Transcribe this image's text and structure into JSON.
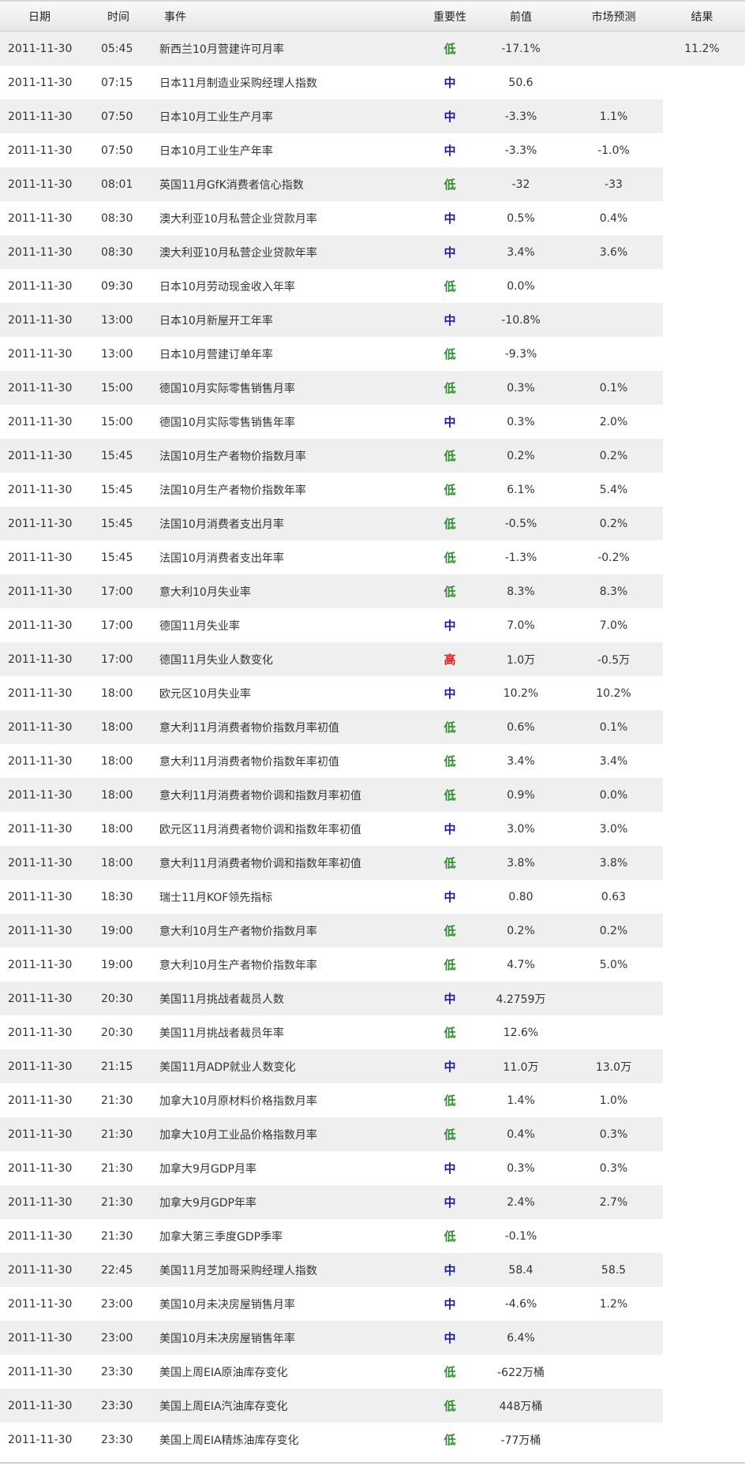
{
  "headers": {
    "date": "日期",
    "time": "时间",
    "event": "事件",
    "importance": "重要性",
    "previous": "前值",
    "forecast": "市场预测",
    "result": "结果"
  },
  "importance_colors": {
    "低": "#2e8b2e",
    "中": "#1a1aa8",
    "高": "#cc2222"
  },
  "rows": [
    {
      "date": "2011-11-30",
      "time": "05:45",
      "event": "新西兰10月营建许可月率",
      "importance": "低",
      "previous": "-17.1%",
      "forecast": "",
      "result": "11.2%"
    },
    {
      "date": "2011-11-30",
      "time": "07:15",
      "event": "日本11月制造业采购经理人指数",
      "importance": "中",
      "previous": "50.6",
      "forecast": "",
      "result": ""
    },
    {
      "date": "2011-11-30",
      "time": "07:50",
      "event": "日本10月工业生产月率",
      "importance": "中",
      "previous": "-3.3%",
      "forecast": "1.1%",
      "result": ""
    },
    {
      "date": "2011-11-30",
      "time": "07:50",
      "event": "日本10月工业生产年率",
      "importance": "中",
      "previous": "-3.3%",
      "forecast": "-1.0%",
      "result": ""
    },
    {
      "date": "2011-11-30",
      "time": "08:01",
      "event": "英国11月GfK消费者信心指数",
      "importance": "低",
      "previous": "-32",
      "forecast": "-33",
      "result": ""
    },
    {
      "date": "2011-11-30",
      "time": "08:30",
      "event": "澳大利亚10月私营企业贷款月率",
      "importance": "中",
      "previous": "0.5%",
      "forecast": "0.4%",
      "result": ""
    },
    {
      "date": "2011-11-30",
      "time": "08:30",
      "event": "澳大利亚10月私营企业贷款年率",
      "importance": "中",
      "previous": "3.4%",
      "forecast": "3.6%",
      "result": ""
    },
    {
      "date": "2011-11-30",
      "time": "09:30",
      "event": "日本10月劳动现金收入年率",
      "importance": "低",
      "previous": "0.0%",
      "forecast": "",
      "result": ""
    },
    {
      "date": "2011-11-30",
      "time": "13:00",
      "event": "日本10月新屋开工年率",
      "importance": "中",
      "previous": "-10.8%",
      "forecast": "",
      "result": ""
    },
    {
      "date": "2011-11-30",
      "time": "13:00",
      "event": "日本10月营建订单年率",
      "importance": "低",
      "previous": "-9.3%",
      "forecast": "",
      "result": ""
    },
    {
      "date": "2011-11-30",
      "time": "15:00",
      "event": "德国10月实际零售销售月率",
      "importance": "低",
      "previous": "0.3%",
      "forecast": "0.1%",
      "result": ""
    },
    {
      "date": "2011-11-30",
      "time": "15:00",
      "event": "德国10月实际零售销售年率",
      "importance": "中",
      "previous": "0.3%",
      "forecast": "2.0%",
      "result": ""
    },
    {
      "date": "2011-11-30",
      "time": "15:45",
      "event": "法国10月生产者物价指数月率",
      "importance": "低",
      "previous": "0.2%",
      "forecast": "0.2%",
      "result": ""
    },
    {
      "date": "2011-11-30",
      "time": "15:45",
      "event": "法国10月生产者物价指数年率",
      "importance": "低",
      "previous": "6.1%",
      "forecast": "5.4%",
      "result": ""
    },
    {
      "date": "2011-11-30",
      "time": "15:45",
      "event": "法国10月消费者支出月率",
      "importance": "低",
      "previous": "-0.5%",
      "forecast": "0.2%",
      "result": ""
    },
    {
      "date": "2011-11-30",
      "time": "15:45",
      "event": "法国10月消费者支出年率",
      "importance": "低",
      "previous": "-1.3%",
      "forecast": "-0.2%",
      "result": ""
    },
    {
      "date": "2011-11-30",
      "time": "17:00",
      "event": "意大利10月失业率",
      "importance": "低",
      "previous": "8.3%",
      "forecast": "8.3%",
      "result": ""
    },
    {
      "date": "2011-11-30",
      "time": "17:00",
      "event": "德国11月失业率",
      "importance": "中",
      "previous": "7.0%",
      "forecast": "7.0%",
      "result": ""
    },
    {
      "date": "2011-11-30",
      "time": "17:00",
      "event": "德国11月失业人数变化",
      "importance": "高",
      "previous": "1.0万",
      "forecast": "-0.5万",
      "result": ""
    },
    {
      "date": "2011-11-30",
      "time": "18:00",
      "event": "欧元区10月失业率",
      "importance": "中",
      "previous": "10.2%",
      "forecast": "10.2%",
      "result": ""
    },
    {
      "date": "2011-11-30",
      "time": "18:00",
      "event": "意大利11月消费者物价指数月率初值",
      "importance": "低",
      "previous": "0.6%",
      "forecast": "0.1%",
      "result": ""
    },
    {
      "date": "2011-11-30",
      "time": "18:00",
      "event": "意大利11月消费者物价指数年率初值",
      "importance": "低",
      "previous": "3.4%",
      "forecast": "3.4%",
      "result": ""
    },
    {
      "date": "2011-11-30",
      "time": "18:00",
      "event": "意大利11月消费者物价调和指数月率初值",
      "importance": "低",
      "previous": "0.9%",
      "forecast": "0.0%",
      "result": ""
    },
    {
      "date": "2011-11-30",
      "time": "18:00",
      "event": "欧元区11月消费者物价调和指数年率初值",
      "importance": "中",
      "previous": "3.0%",
      "forecast": "3.0%",
      "result": ""
    },
    {
      "date": "2011-11-30",
      "time": "18:00",
      "event": "意大利11月消费者物价调和指数年率初值",
      "importance": "低",
      "previous": "3.8%",
      "forecast": "3.8%",
      "result": ""
    },
    {
      "date": "2011-11-30",
      "time": "18:30",
      "event": "瑞士11月KOF领先指标",
      "importance": "中",
      "previous": "0.80",
      "forecast": "0.63",
      "result": ""
    },
    {
      "date": "2011-11-30",
      "time": "19:00",
      "event": "意大利10月生产者物价指数月率",
      "importance": "低",
      "previous": "0.2%",
      "forecast": "0.2%",
      "result": ""
    },
    {
      "date": "2011-11-30",
      "time": "19:00",
      "event": "意大利10月生产者物价指数年率",
      "importance": "低",
      "previous": "4.7%",
      "forecast": "5.0%",
      "result": ""
    },
    {
      "date": "2011-11-30",
      "time": "20:30",
      "event": "美国11月挑战者裁员人数",
      "importance": "中",
      "previous": "4.2759万",
      "forecast": "",
      "result": ""
    },
    {
      "date": "2011-11-30",
      "time": "20:30",
      "event": "美国11月挑战者裁员年率",
      "importance": "低",
      "previous": "12.6%",
      "forecast": "",
      "result": ""
    },
    {
      "date": "2011-11-30",
      "time": "21:15",
      "event": "美国11月ADP就业人数变化",
      "importance": "中",
      "previous": "11.0万",
      "forecast": "13.0万",
      "result": ""
    },
    {
      "date": "2011-11-30",
      "time": "21:30",
      "event": "加拿大10月原材料价格指数月率",
      "importance": "低",
      "previous": "1.4%",
      "forecast": "1.0%",
      "result": ""
    },
    {
      "date": "2011-11-30",
      "time": "21:30",
      "event": "加拿大10月工业品价格指数月率",
      "importance": "低",
      "previous": "0.4%",
      "forecast": "0.3%",
      "result": ""
    },
    {
      "date": "2011-11-30",
      "time": "21:30",
      "event": "加拿大9月GDP月率",
      "importance": "中",
      "previous": "0.3%",
      "forecast": "0.3%",
      "result": ""
    },
    {
      "date": "2011-11-30",
      "time": "21:30",
      "event": "加拿大9月GDP年率",
      "importance": "中",
      "previous": "2.4%",
      "forecast": "2.7%",
      "result": ""
    },
    {
      "date": "2011-11-30",
      "time": "21:30",
      "event": "加拿大第三季度GDP季率",
      "importance": "低",
      "previous": "-0.1%",
      "forecast": "",
      "result": ""
    },
    {
      "date": "2011-11-30",
      "time": "22:45",
      "event": "美国11月芝加哥采购经理人指数",
      "importance": "中",
      "previous": "58.4",
      "forecast": "58.5",
      "result": ""
    },
    {
      "date": "2011-11-30",
      "time": "23:00",
      "event": "美国10月未决房屋销售月率",
      "importance": "中",
      "previous": "-4.6%",
      "forecast": "1.2%",
      "result": ""
    },
    {
      "date": "2011-11-30",
      "time": "23:00",
      "event": "美国10月未决房屋销售年率",
      "importance": "中",
      "previous": "6.4%",
      "forecast": "",
      "result": ""
    },
    {
      "date": "2011-11-30",
      "time": "23:30",
      "event": "美国上周EIA原油库存变化",
      "importance": "低",
      "previous": "-622万桶",
      "forecast": "",
      "result": ""
    },
    {
      "date": "2011-11-30",
      "time": "23:30",
      "event": "美国上周EIA汽油库存变化",
      "importance": "低",
      "previous": "448万桶",
      "forecast": "",
      "result": ""
    },
    {
      "date": "2011-11-30",
      "time": "23:30",
      "event": "美国上周EIA精炼油库存变化",
      "importance": "低",
      "previous": "-77万桶",
      "forecast": "",
      "result": ""
    }
  ]
}
